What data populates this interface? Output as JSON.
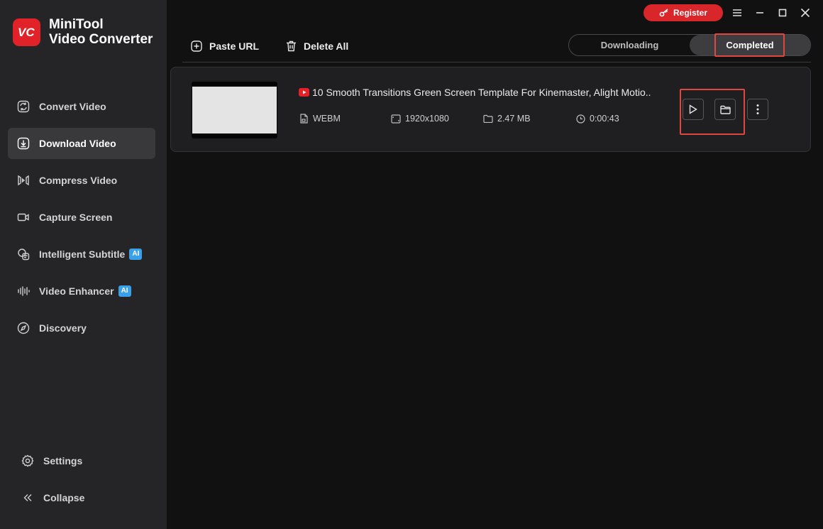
{
  "app": {
    "name_line1": "MiniTool",
    "name_line2": "Video Converter",
    "logo_text": "VC",
    "brand_color": "#e12228"
  },
  "sidebar": {
    "items": [
      {
        "label": "Convert Video",
        "icon": "convert-icon",
        "active": false
      },
      {
        "label": "Download Video",
        "icon": "download-icon",
        "active": true
      },
      {
        "label": "Compress Video",
        "icon": "compress-icon",
        "active": false
      },
      {
        "label": "Capture Screen",
        "icon": "camera-icon",
        "active": false
      },
      {
        "label": "Intelligent Subtitle",
        "icon": "subtitle-icon",
        "badge": "AI",
        "active": false
      },
      {
        "label": "Video Enhancer",
        "icon": "enhancer-icon",
        "badge": "AI",
        "active": false
      },
      {
        "label": "Discovery",
        "icon": "compass-icon",
        "active": false
      }
    ],
    "bottom": {
      "settings_label": "Settings",
      "collapse_label": "Collapse"
    }
  },
  "titlebar": {
    "register_label": "Register"
  },
  "toolbar": {
    "paste_url_label": "Paste URL",
    "delete_all_label": "Delete All"
  },
  "tabs": {
    "downloading_label": "Downloading",
    "completed_label": "Completed",
    "selected": "Completed"
  },
  "downloads": [
    {
      "title": "10 Smooth Transitions Green Screen Template For Kinemaster, Alight Motio..",
      "source_icon": "youtube-icon",
      "format": "WEBM",
      "resolution": "1920x1080",
      "size": "2.47 MB",
      "duration": "0:00:43"
    }
  ],
  "colors": {
    "accent_red": "#d8262b",
    "highlight": "#e0473e",
    "ai_badge": "#3aa0e8"
  }
}
